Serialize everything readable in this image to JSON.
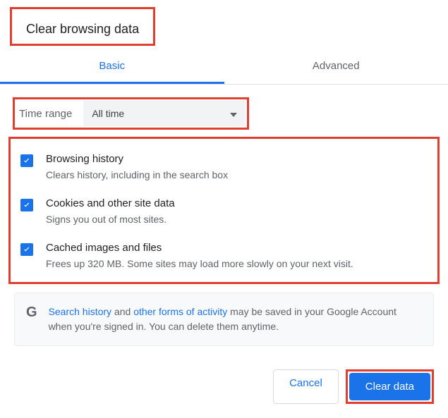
{
  "dialog": {
    "title": "Clear browsing data"
  },
  "tabs": {
    "basic": "Basic",
    "advanced": "Advanced"
  },
  "timeRange": {
    "label": "Time range",
    "selected": "All time"
  },
  "options": [
    {
      "title": "Browsing history",
      "desc": "Clears history, including in the search box"
    },
    {
      "title": "Cookies and other site data",
      "desc": "Signs you out of most sites."
    },
    {
      "title": "Cached images and files",
      "desc": "Frees up 320 MB. Some sites may load more slowly on your next visit."
    }
  ],
  "info": {
    "link1": "Search history",
    "mid1": " and ",
    "link2": "other forms of activity",
    "rest": " may be saved in your Google Account when you're signed in. You can delete them anytime."
  },
  "buttons": {
    "cancel": "Cancel",
    "clear": "Clear data"
  }
}
